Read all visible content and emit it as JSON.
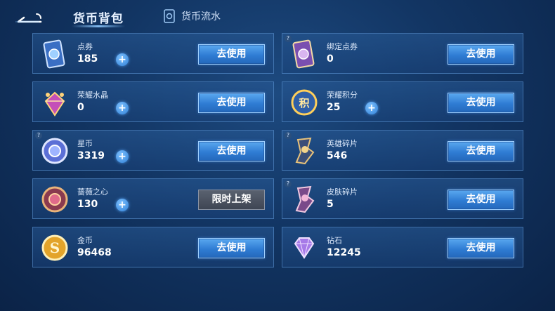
{
  "header": {
    "title": "货币背包",
    "flow_tab": "货币流水"
  },
  "cards": [
    {
      "name": "点券",
      "value": "185",
      "action": "去使用",
      "icon": "voucher-card-icon"
    },
    {
      "name": "绑定点券",
      "value": "0",
      "action": "去使用",
      "icon": "bound-voucher-card-icon"
    },
    {
      "name": "荣耀水晶",
      "value": "0",
      "action": "去使用",
      "icon": "honor-crystal-icon"
    },
    {
      "name": "荣耀积分",
      "value": "25",
      "action": "去使用",
      "icon": "honor-points-icon"
    },
    {
      "name": "星币",
      "value": "3319",
      "action": "去使用",
      "icon": "star-coin-icon"
    },
    {
      "name": "英雄碎片",
      "value": "546",
      "action": "去使用",
      "icon": "hero-fragment-icon"
    },
    {
      "name": "蔷薇之心",
      "value": "130",
      "action": "限时上架",
      "icon": "rose-heart-icon"
    },
    {
      "name": "皮肤碎片",
      "value": "5",
      "action": "去使用",
      "icon": "skin-fragment-icon"
    },
    {
      "name": "金币",
      "value": "96468",
      "action": "去使用",
      "icon": "gold-coin-icon"
    },
    {
      "name": "钻石",
      "value": "12245",
      "action": "去使用",
      "icon": "diamond-icon"
    }
  ],
  "colors": {
    "accent": "#2f7cd3",
    "disabled": "#4a5260",
    "background": "#123563"
  }
}
